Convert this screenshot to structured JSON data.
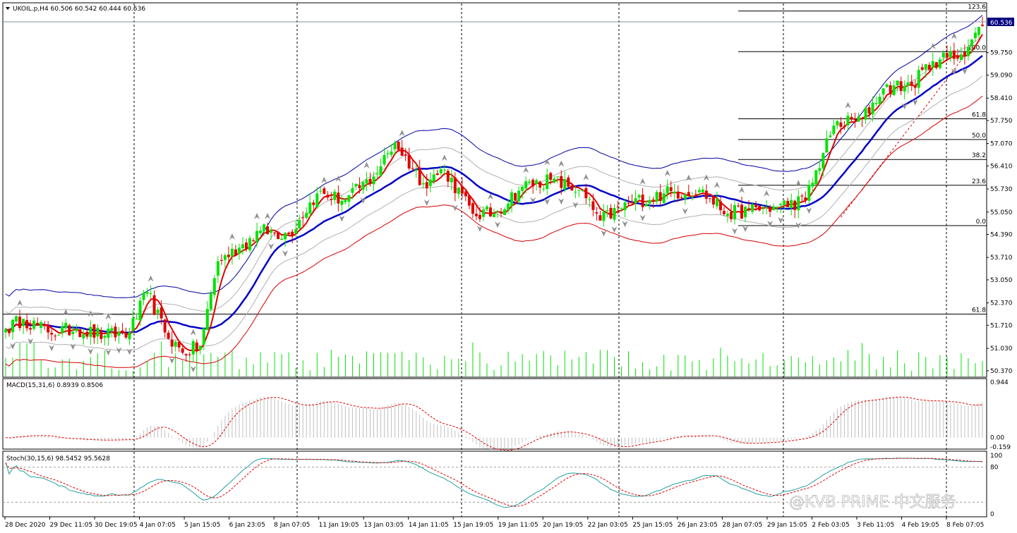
{
  "symbol_header": "UKOIL.p,H4  60.506 60.542 60.444 60.536",
  "current_price": "60.536",
  "price_axis_labels": [
    "59.750",
    "59.090",
    "58.410",
    "57.750",
    "57.070",
    "56.410",
    "55.730",
    "55.050",
    "54.390",
    "53.710",
    "53.050",
    "52.370",
    "51.710",
    "51.030",
    "50.370"
  ],
  "fib_levels": [
    {
      "label": "123.6",
      "price": 60.98
    },
    {
      "label": "100.0",
      "price": 59.78
    },
    {
      "label": "61.8",
      "price": 57.8
    },
    {
      "label": "50.0",
      "price": 57.19
    },
    {
      "label": "38.2",
      "price": 56.6
    },
    {
      "label": "23.6",
      "price": 55.84
    },
    {
      "label": "0.0",
      "price": 54.65
    }
  ],
  "fib_left_level": {
    "label": "61.8",
    "price": 52.04
  },
  "time_labels": [
    "28 Dec 2020",
    "29 Dec 11:05",
    "30 Dec 19:05",
    "4 Jan 07:05",
    "5 Jan 15:05",
    "6 Jan 23:05",
    "8 Jan 07:05",
    "11 Jan 19:05",
    "13 Jan 03:05",
    "14 Jan 11:05",
    "15 Jan 19:05",
    "19 Jan 11:05",
    "20 Jan 19:05",
    "22 Jan 03:05",
    "25 Jan 15:05",
    "26 Jan 23:05",
    "28 Jan 07:05",
    "29 Jan 15:05",
    "2 Feb 03:05",
    "3 Feb 11:05",
    "4 Feb 19:05",
    "8 Feb 07:05"
  ],
  "macd": {
    "header": "MACD(15,31,6) 0.8939 0.8506",
    "axis_labels": [
      "0.944",
      "0.00",
      "-0.159"
    ]
  },
  "stoch": {
    "header": "Stoch(30,15,6) 98.5452 95.5628",
    "axis_labels": [
      "100",
      "80",
      "0"
    ]
  },
  "watermark": "@KVB PRIME 中文服务",
  "colors": {
    "bull": "#00e400",
    "bear": "#e00000",
    "ma_fast": "#e00000",
    "ma_mid": "#0000a0",
    "ma_slow": "#0000c8",
    "env_low": "#d40000",
    "grid": "#000000"
  },
  "chart_data": {
    "type": "candlestick",
    "instrument": "UKOIL.p",
    "timeframe": "H4",
    "ylim": [
      50.2,
      61.2
    ],
    "anchors": [
      {
        "t": 0,
        "v": 51.6
      },
      {
        "t": 5,
        "v": 51.9
      },
      {
        "t": 12,
        "v": 51.5
      },
      {
        "t": 20,
        "v": 51.6
      },
      {
        "t": 28,
        "v": 51.4
      },
      {
        "t": 35,
        "v": 51.5
      },
      {
        "t": 40,
        "v": 52.7
      },
      {
        "t": 45,
        "v": 51.5
      },
      {
        "t": 50,
        "v": 50.9
      },
      {
        "t": 55,
        "v": 51.1
      },
      {
        "t": 60,
        "v": 53.6
      },
      {
        "t": 66,
        "v": 54.0
      },
      {
        "t": 72,
        "v": 54.5
      },
      {
        "t": 80,
        "v": 54.4
      },
      {
        "t": 88,
        "v": 55.6
      },
      {
        "t": 96,
        "v": 55.4
      },
      {
        "t": 104,
        "v": 56.1
      },
      {
        "t": 110,
        "v": 57.1
      },
      {
        "t": 118,
        "v": 55.9
      },
      {
        "t": 124,
        "v": 56.3
      },
      {
        "t": 132,
        "v": 55.0
      },
      {
        "t": 138,
        "v": 55.0
      },
      {
        "t": 146,
        "v": 55.8
      },
      {
        "t": 154,
        "v": 56.0
      },
      {
        "t": 162,
        "v": 55.7
      },
      {
        "t": 168,
        "v": 54.8
      },
      {
        "t": 176,
        "v": 55.3
      },
      {
        "t": 186,
        "v": 55.6
      },
      {
        "t": 196,
        "v": 55.7
      },
      {
        "t": 204,
        "v": 55.0
      },
      {
        "t": 210,
        "v": 55.1
      },
      {
        "t": 218,
        "v": 55.2
      },
      {
        "t": 226,
        "v": 55.4
      },
      {
        "t": 234,
        "v": 57.6
      },
      {
        "t": 242,
        "v": 57.8
      },
      {
        "t": 248,
        "v": 58.7
      },
      {
        "t": 256,
        "v": 58.8
      },
      {
        "t": 262,
        "v": 59.5
      },
      {
        "t": 270,
        "v": 59.7
      },
      {
        "t": 276,
        "v": 60.54
      }
    ]
  }
}
